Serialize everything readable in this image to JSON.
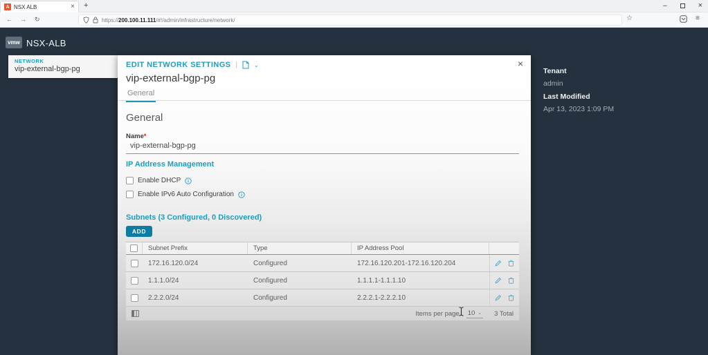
{
  "colors": {
    "accent_teal": "#1b9dc0",
    "primary_button": "#0d7ca4",
    "dark_background": "#25313e",
    "required_red": "#c92100",
    "favicon_orange": "#e8562d"
  },
  "icons": {
    "close": "×",
    "plus": "+",
    "minimize": "–",
    "star": "☆",
    "menu": "≡",
    "chevron_down": "⌄",
    "pipe": "|",
    "back_arrow": "←",
    "forward_arrow": "→",
    "reload": "↻",
    "favicon_letter": "A"
  },
  "browser": {
    "tab": {
      "title": "NSX ALB"
    },
    "address": {
      "protocol": "https://",
      "host": "200.100.11.111",
      "path": "/#!/admin/infrastructure/network/"
    }
  },
  "app": {
    "logo": "vmw",
    "product": "NSX-ALB",
    "nav_card": {
      "kicker": "NETWORK",
      "title": "vip-external-bgp-pg"
    }
  },
  "modal": {
    "header_title": "EDIT NETWORK SETTINGS",
    "title": "vip-external-bgp-pg",
    "tab": "General",
    "section_heading": "General",
    "name_field": {
      "label": "Name",
      "required_marker": "*",
      "value": "vip-external-bgp-pg"
    },
    "ipam_heading": "IP Address Management",
    "checkboxes": [
      {
        "label": "Enable DHCP"
      },
      {
        "label": "Enable IPv6 Auto Configuration"
      }
    ],
    "subnets_heading": "Subnets (3 Configured, 0 Discovered)",
    "add_button": "ADD",
    "table": {
      "columns": [
        "Subnet Prefix",
        "Type",
        "IP Address Pool"
      ],
      "rows": [
        {
          "subnet_prefix": "172.16.120.0/24",
          "type": "Configured",
          "ip_address_pool": "172.16.120.201-172.16.120.204"
        },
        {
          "subnet_prefix": "1.1.1.0/24",
          "type": "Configured",
          "ip_address_pool": "1.1.1.1-1.1.1.10"
        },
        {
          "subnet_prefix": "2.2.2.0/24",
          "type": "Configured",
          "ip_address_pool": "2.2.2.1-2.2.2.10"
        }
      ],
      "footer": {
        "items_per_page_label": "Items per page",
        "items_per_page_value": "10",
        "total": "3 Total"
      }
    }
  },
  "info_panel": {
    "tenant_label": "Tenant",
    "tenant_value": "admin",
    "last_modified_label": "Last Modified",
    "last_modified_value": "Apr 13, 2023 1:09 PM"
  }
}
